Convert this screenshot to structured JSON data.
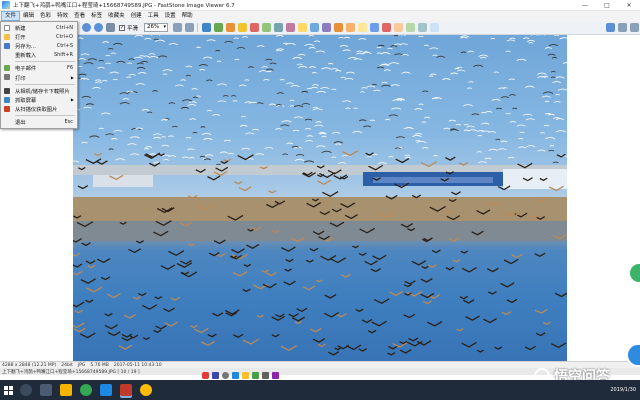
{
  "window": {
    "title": "上下翻飞+鸿鹊+鸭嘴江口+程莹琦+15668749589.JPG - FastStone Image Viewer 6.7",
    "minimize": "—",
    "maximize": "□",
    "close": "✕"
  },
  "menubar": {
    "items": [
      {
        "label": "文件",
        "active": true
      },
      {
        "label": "编辑"
      },
      {
        "label": "色彩"
      },
      {
        "label": "特效"
      },
      {
        "label": "查看"
      },
      {
        "label": "标签"
      },
      {
        "label": "收藏夹"
      },
      {
        "label": "创建"
      },
      {
        "label": "工具"
      },
      {
        "label": "设置"
      },
      {
        "label": "帮助"
      }
    ]
  },
  "toolbar": {
    "smooth_label": "平滑",
    "smooth_checked": "✓",
    "zoom_value": "26%"
  },
  "file_menu": {
    "items": [
      {
        "label": "新建",
        "shortcut": "Ctrl+N",
        "icon": "new-icon",
        "color": "#ffffff"
      },
      {
        "label": "打开",
        "shortcut": "Ctrl+O",
        "icon": "open-folder-icon",
        "color": "#f3c14a"
      },
      {
        "label": "另存为...",
        "shortcut": "Ctrl+S",
        "icon": "save-as-icon",
        "color": "#4a78c8"
      },
      {
        "label": "重新载入",
        "shortcut": "Shift+R",
        "icon": "reload-icon",
        "color": "#ffffff"
      },
      {
        "sep": true
      },
      {
        "label": "电子邮件",
        "shortcut": "F6",
        "icon": "email-icon",
        "color": "#6aa84f"
      },
      {
        "label": "打印",
        "shortcut": "",
        "icon": "print-icon",
        "color": "#777777",
        "submenu": true
      },
      {
        "sep": true
      },
      {
        "label": "从相机/储存卡下载照片",
        "shortcut": "",
        "icon": "camera-icon",
        "color": "#444444"
      },
      {
        "label": "抓取屏幕",
        "shortcut": "",
        "icon": "screenshot-icon",
        "color": "#3d85c6",
        "submenu": true
      },
      {
        "label": "从扫描仪获取图片",
        "shortcut": "",
        "icon": "scanner-icon",
        "color": "#cc4125"
      },
      {
        "sep": true
      },
      {
        "label": "退出",
        "shortcut": "Esc",
        "icon": "exit-icon",
        "color": "#ffffff"
      }
    ]
  },
  "status": {
    "dimensions": "4288 x 2848 (12.21 MP)",
    "depth": "24bit",
    "format": "JPG",
    "size": "5.76 MB",
    "date": "2017-05-11 10:43:10",
    "file_line": "上下翻飞+鸿鹊+鸭嘴江口+程莹琦+15668749589.JPG [ 10 / 19 ]"
  },
  "watermark": {
    "text": "悟空问答"
  },
  "tray": {
    "date": "2019/1/30"
  }
}
